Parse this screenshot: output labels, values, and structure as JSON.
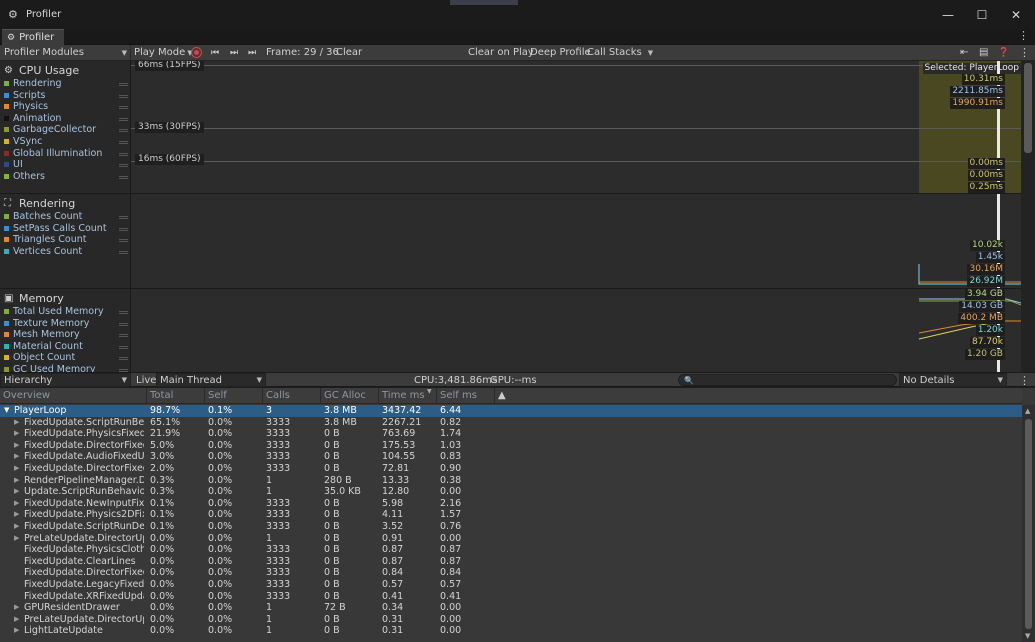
{
  "window": {
    "title": "Profiler",
    "tab_label": "Profiler"
  },
  "toolbar": {
    "modules_label": "Profiler Modules",
    "play_mode_label": "Play Mode",
    "frame_label": "Frame: 29 / 36",
    "clear_label": "Clear",
    "clear_on_play_label": "Clear on Play",
    "deep_profile_label": "Deep Profile",
    "call_stacks_label": "Call Stacks"
  },
  "modules": [
    {
      "title": "CPU Usage",
      "icon": "cpu-icon",
      "items": [
        {
          "label": "Rendering",
          "color": "#7fae3d"
        },
        {
          "label": "Scripts",
          "color": "#3a8ed4"
        },
        {
          "label": "Physics",
          "color": "#e08a2c"
        },
        {
          "label": "Animation",
          "color": "#111111"
        },
        {
          "label": "GarbageCollector",
          "color": "#8a9a2a"
        },
        {
          "label": "VSync",
          "color": "#d6b800"
        },
        {
          "label": "Global Illumination",
          "color": "#8a2a2a"
        },
        {
          "label": "UI",
          "color": "#2a4a8a"
        },
        {
          "label": "Others",
          "color": "#8ab52a"
        }
      ]
    },
    {
      "title": "Rendering",
      "icon": "rendering-icon",
      "items": [
        {
          "label": "Batches Count",
          "color": "#7fae3d"
        },
        {
          "label": "SetPass Calls Count",
          "color": "#3a8ed4"
        },
        {
          "label": "Triangles Count",
          "color": "#e08a2c"
        },
        {
          "label": "Vertices Count",
          "color": "#2ab5b5"
        }
      ]
    },
    {
      "title": "Memory",
      "icon": "memory-icon",
      "items": [
        {
          "label": "Total Used Memory",
          "color": "#7fae3d"
        },
        {
          "label": "Texture Memory",
          "color": "#3a8ed4"
        },
        {
          "label": "Mesh Memory",
          "color": "#e08a2c"
        },
        {
          "label": "Material Count",
          "color": "#2ab5b5"
        },
        {
          "label": "Object Count",
          "color": "#d6b800"
        },
        {
          "label": "GC Used Memory",
          "color": "#8a9a2a"
        }
      ]
    }
  ],
  "cpu_graph": {
    "fps_lines": [
      "66ms (15FPS)",
      "33ms (30FPS)",
      "16ms (60FPS)"
    ],
    "selected_label": "Selected: PlayerLoop",
    "values_top": [
      {
        "text": "10.31ms",
        "color": "#d0c46c"
      },
      {
        "text": "2211.85ms",
        "color": "#9fc3ea"
      },
      {
        "text": "1990.91ms",
        "color": "#e8a35a"
      }
    ],
    "values_bottom": [
      {
        "text": "0.00ms",
        "color": "#d0c46c"
      },
      {
        "text": "0.00ms",
        "color": "#d0c46c"
      },
      {
        "text": "0.25ms",
        "color": "#d0c46c"
      }
    ]
  },
  "rendering_graph": {
    "values": [
      {
        "text": "10.02k",
        "color": "#b8d67c"
      },
      {
        "text": "1.45k",
        "color": "#9fc3ea"
      },
      {
        "text": "30.16M",
        "color": "#e8a35a"
      },
      {
        "text": "26.92M",
        "color": "#7fd6d6"
      }
    ]
  },
  "memory_graph": {
    "values": [
      {
        "text": "3.94 GB",
        "color": "#b8d67c"
      },
      {
        "text": "14.03 GB",
        "color": "#9fc3ea"
      },
      {
        "text": "400.2 MB",
        "color": "#e8a35a"
      },
      {
        "text": "1.20k",
        "color": "#7fd6d6"
      },
      {
        "text": "87.70k",
        "color": "#e0d060"
      },
      {
        "text": "1.20 GB",
        "color": "#c0c070"
      }
    ]
  },
  "hierarchy_bar": {
    "view_label": "Hierarchy",
    "live_label": "Live",
    "thread_label": "Main Thread",
    "cpu_label": "CPU:3,481.86ms",
    "gpu_label": "GPU:--ms",
    "details_label": "No Details"
  },
  "table": {
    "columns": [
      "Overview",
      "Total",
      "Self",
      "Calls",
      "GC Alloc",
      "Time ms",
      "Self ms"
    ],
    "rows": [
      {
        "name": "PlayerLoop",
        "total": "98.7%",
        "self": "0.1%",
        "calls": "3",
        "gc": "3.8 MB",
        "time": "3437.42",
        "selfms": "6.44",
        "expander": "open",
        "indent": 0
      },
      {
        "name": "FixedUpdate.ScriptRunBehav",
        "total": "65.1%",
        "self": "0.0%",
        "calls": "3333",
        "gc": "3.8 MB",
        "time": "2267.21",
        "selfms": "0.82",
        "expander": "closed",
        "indent": 1
      },
      {
        "name": "FixedUpdate.PhysicsFixedUp",
        "total": "21.9%",
        "self": "0.0%",
        "calls": "3333",
        "gc": "0 B",
        "time": "763.69",
        "selfms": "1.74",
        "expander": "closed",
        "indent": 1
      },
      {
        "name": "FixedUpdate.DirectorFixedUp",
        "total": "5.0%",
        "self": "0.0%",
        "calls": "3333",
        "gc": "0 B",
        "time": "175.53",
        "selfms": "1.03",
        "expander": "closed",
        "indent": 1
      },
      {
        "name": "FixedUpdate.AudioFixedUpda",
        "total": "3.0%",
        "self": "0.0%",
        "calls": "3333",
        "gc": "0 B",
        "time": "104.55",
        "selfms": "0.83",
        "expander": "closed",
        "indent": 1
      },
      {
        "name": "FixedUpdate.DirectorFixedUp",
        "total": "2.0%",
        "self": "0.0%",
        "calls": "3333",
        "gc": "0 B",
        "time": "72.81",
        "selfms": "0.90",
        "expander": "closed",
        "indent": 1
      },
      {
        "name": "RenderPipelineManager.DoRe",
        "total": "0.3%",
        "self": "0.0%",
        "calls": "1",
        "gc": "280 B",
        "time": "13.33",
        "selfms": "0.38",
        "expander": "closed",
        "indent": 1
      },
      {
        "name": "Update.ScriptRunBehaviourU",
        "total": "0.3%",
        "self": "0.0%",
        "calls": "1",
        "gc": "35.0 KB",
        "time": "12.80",
        "selfms": "0.00",
        "expander": "closed",
        "indent": 1
      },
      {
        "name": "FixedUpdate.NewInputFixedU",
        "total": "0.1%",
        "self": "0.0%",
        "calls": "3333",
        "gc": "0 B",
        "time": "5.98",
        "selfms": "2.16",
        "expander": "closed",
        "indent": 1
      },
      {
        "name": "FixedUpdate.Physics2DFixed",
        "total": "0.1%",
        "self": "0.0%",
        "calls": "3333",
        "gc": "0 B",
        "time": "4.11",
        "selfms": "1.57",
        "expander": "closed",
        "indent": 1
      },
      {
        "name": "FixedUpdate.ScriptRunDelaye",
        "total": "0.1%",
        "self": "0.0%",
        "calls": "3333",
        "gc": "0 B",
        "time": "3.52",
        "selfms": "0.76",
        "expander": "closed",
        "indent": 1
      },
      {
        "name": "PreLateUpdate.DirectorUpda",
        "total": "0.0%",
        "self": "0.0%",
        "calls": "1",
        "gc": "0 B",
        "time": "0.91",
        "selfms": "0.00",
        "expander": "closed",
        "indent": 1
      },
      {
        "name": "FixedUpdate.PhysicsClothFix",
        "total": "0.0%",
        "self": "0.0%",
        "calls": "3333",
        "gc": "0 B",
        "time": "0.87",
        "selfms": "0.87",
        "expander": "none",
        "indent": 1
      },
      {
        "name": "FixedUpdate.ClearLines",
        "total": "0.0%",
        "self": "0.0%",
        "calls": "3333",
        "gc": "0 B",
        "time": "0.87",
        "selfms": "0.87",
        "expander": "none",
        "indent": 1
      },
      {
        "name": "FixedUpdate.DirectorFixedSa",
        "total": "0.0%",
        "self": "0.0%",
        "calls": "3333",
        "gc": "0 B",
        "time": "0.84",
        "selfms": "0.84",
        "expander": "none",
        "indent": 1
      },
      {
        "name": "FixedUpdate.LegacyFixedAni",
        "total": "0.0%",
        "self": "0.0%",
        "calls": "3333",
        "gc": "0 B",
        "time": "0.57",
        "selfms": "0.57",
        "expander": "none",
        "indent": 1
      },
      {
        "name": "FixedUpdate.XRFixedUpdate",
        "total": "0.0%",
        "self": "0.0%",
        "calls": "3333",
        "gc": "0 B",
        "time": "0.41",
        "selfms": "0.41",
        "expander": "none",
        "indent": 1
      },
      {
        "name": "GPUResidentDrawer",
        "total": "0.0%",
        "self": "0.0%",
        "calls": "1",
        "gc": "72 B",
        "time": "0.34",
        "selfms": "0.00",
        "expander": "closed",
        "indent": 1
      },
      {
        "name": "PreLateUpdate.DirectorUpda",
        "total": "0.0%",
        "self": "0.0%",
        "calls": "1",
        "gc": "0 B",
        "time": "0.31",
        "selfms": "0.00",
        "expander": "closed",
        "indent": 1
      },
      {
        "name": "LightLateUpdate",
        "total": "0.0%",
        "self": "0.0%",
        "calls": "1",
        "gc": "0 B",
        "time": "0.31",
        "selfms": "0.00",
        "expander": "closed",
        "indent": 1
      }
    ]
  }
}
